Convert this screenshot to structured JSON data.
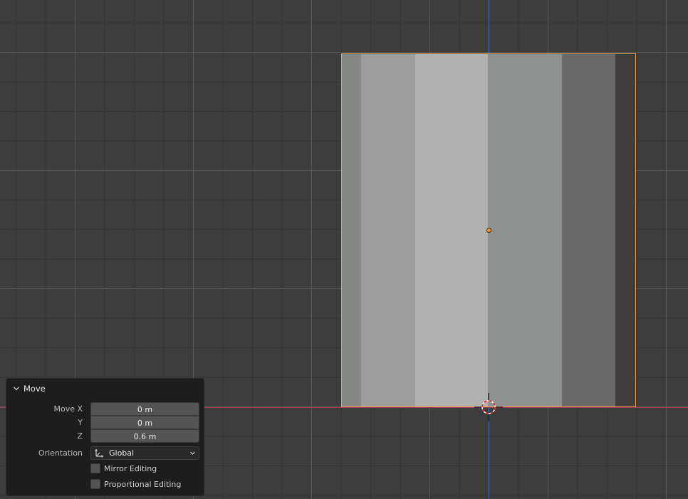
{
  "viewport": {
    "colors": {
      "background": "#3d3d3d",
      "x_axis": "#a3404b",
      "z_axis": "#3b6ec4",
      "selection_outline": "#f0a040",
      "origin": "#ff9a28"
    },
    "mesh_shade_bands": [
      "#868886",
      "#9c9d9c",
      "#b0b1b0",
      "#8f9090",
      "#6a6a6a",
      "#3f3d3d"
    ]
  },
  "operator_panel": {
    "title": "Move",
    "fields": [
      {
        "label": "Move X",
        "value": "0 m"
      },
      {
        "label": "Y",
        "value": "0 m"
      },
      {
        "label": "Z",
        "value": "0.6 m"
      }
    ],
    "orientation": {
      "label": "Orientation",
      "value": "Global",
      "icon": "orientation-axes-icon"
    },
    "checkboxes": [
      {
        "label": "Mirror Editing",
        "checked": false
      },
      {
        "label": "Proportional Editing",
        "checked": false
      }
    ]
  }
}
